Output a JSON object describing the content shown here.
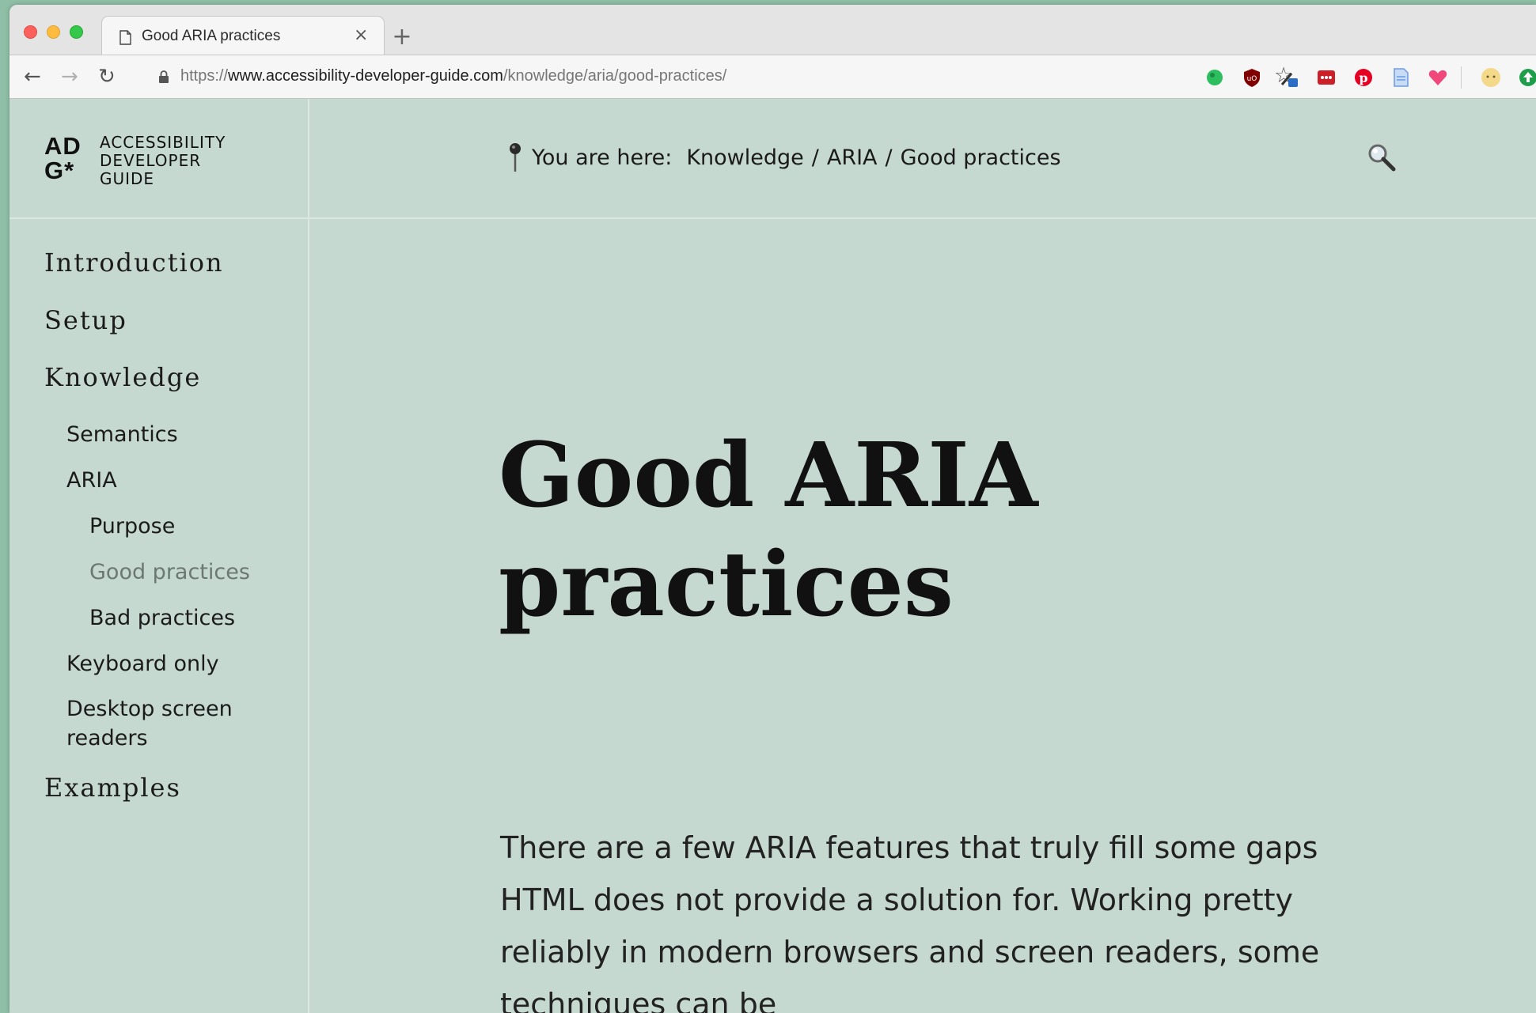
{
  "browser": {
    "tab_title": "Good ARIA practices",
    "tab_close": "×",
    "new_tab": "+",
    "url_prefix": "https://",
    "url_host": "www.accessibility-developer-guide.com",
    "url_path": "/knowledge/aria/good-practices/",
    "extensions": [
      "evernote-icon",
      "ublock-icon",
      "eyedropper-icon",
      "lastpass-icon",
      "pinterest-icon",
      "docs-icon",
      "pocket-heart-icon",
      "avatar-icon",
      "update-icon"
    ]
  },
  "logo": {
    "mark_line1": "AD",
    "mark_line2": "G*",
    "text_line1": "ACCESSIBILITY",
    "text_line2": "DEVELOPER",
    "text_line3": "GUIDE"
  },
  "breadcrumb": {
    "prefix": "You are here:",
    "items": [
      "Knowledge",
      "ARIA",
      "Good practices"
    ],
    "separator": "/"
  },
  "sidebar": {
    "introduction": "Introduction",
    "setup": "Setup",
    "knowledge": "Knowledge",
    "semantics": "Semantics",
    "aria": "ARIA",
    "purpose": "Purpose",
    "good_practices": "Good practices",
    "bad_practices": "Bad practices",
    "keyboard_only": "Keyboard only",
    "desktop_screen_readers_1": "Desktop screen",
    "desktop_screen_readers_2": "readers",
    "examples": "Examples"
  },
  "main": {
    "title_line1": "Good ARIA",
    "title_line2": "practices",
    "intro": "There are a few ARIA features that truly fill some gaps HTML does not provide a solution for. Working pretty reliably in modern browsers and screen readers, some techniques can be"
  },
  "colors": {
    "page_bg": "#c6d9d0",
    "active_nav": "#6b7873"
  }
}
